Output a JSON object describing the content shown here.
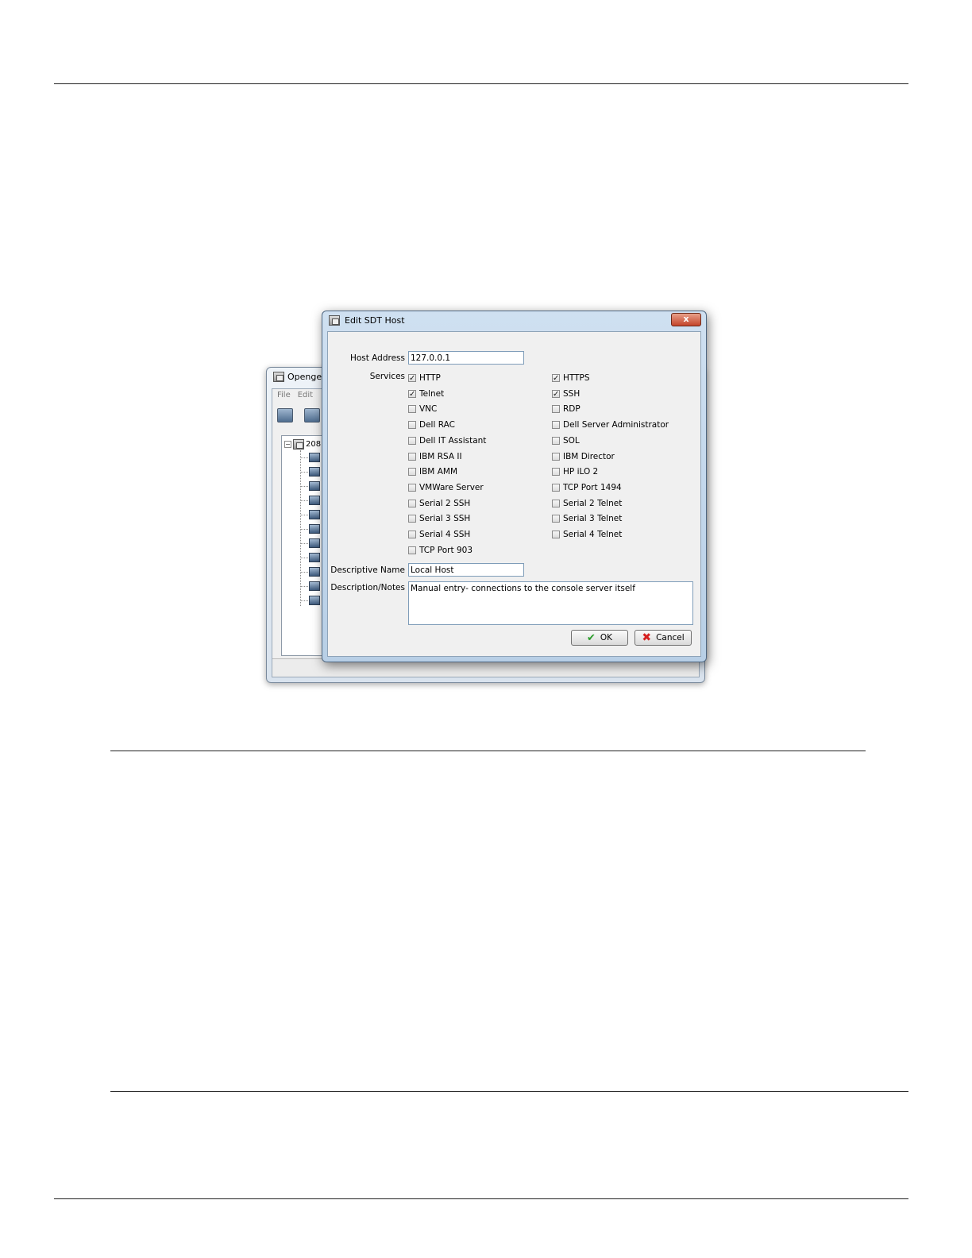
{
  "background_window": {
    "title": "Opengea",
    "menu": [
      "File",
      "Edit"
    ],
    "tree_root_label": "208"
  },
  "dialog": {
    "title": "Edit SDT Host",
    "close_label": "x",
    "host_address_label": "Host Address",
    "host_address_value": "127.0.0.1",
    "services_label": "Services",
    "services_left": [
      {
        "label": "HTTP",
        "checked": true
      },
      {
        "label": "Telnet",
        "checked": true
      },
      {
        "label": "VNC",
        "checked": false
      },
      {
        "label": "Dell RAC",
        "checked": false
      },
      {
        "label": "Dell IT Assistant",
        "checked": false
      },
      {
        "label": "IBM RSA II",
        "checked": false
      },
      {
        "label": "IBM AMM",
        "checked": false
      },
      {
        "label": "VMWare Server",
        "checked": false
      },
      {
        "label": "Serial 2 SSH",
        "checked": false
      },
      {
        "label": "Serial 3 SSH",
        "checked": false
      },
      {
        "label": "Serial 4 SSH",
        "checked": false
      },
      {
        "label": "TCP Port 903",
        "checked": false
      }
    ],
    "services_right": [
      {
        "label": "HTTPS",
        "checked": true
      },
      {
        "label": "SSH",
        "checked": true
      },
      {
        "label": "RDP",
        "checked": false
      },
      {
        "label": "Dell Server Administrator",
        "checked": false
      },
      {
        "label": "SOL",
        "checked": false
      },
      {
        "label": "IBM Director",
        "checked": false
      },
      {
        "label": "HP iLO 2",
        "checked": false
      },
      {
        "label": "TCP Port 1494",
        "checked": false
      },
      {
        "label": "Serial 2 Telnet",
        "checked": false
      },
      {
        "label": "Serial 3 Telnet",
        "checked": false
      },
      {
        "label": "Serial 4 Telnet",
        "checked": false
      }
    ],
    "descriptive_name_label": "Descriptive Name",
    "descriptive_name_value": "Local Host",
    "notes_label": "Description/Notes",
    "notes_value": "Manual entry- connections to the console server itself",
    "ok_label": "OK",
    "cancel_label": "Cancel"
  }
}
